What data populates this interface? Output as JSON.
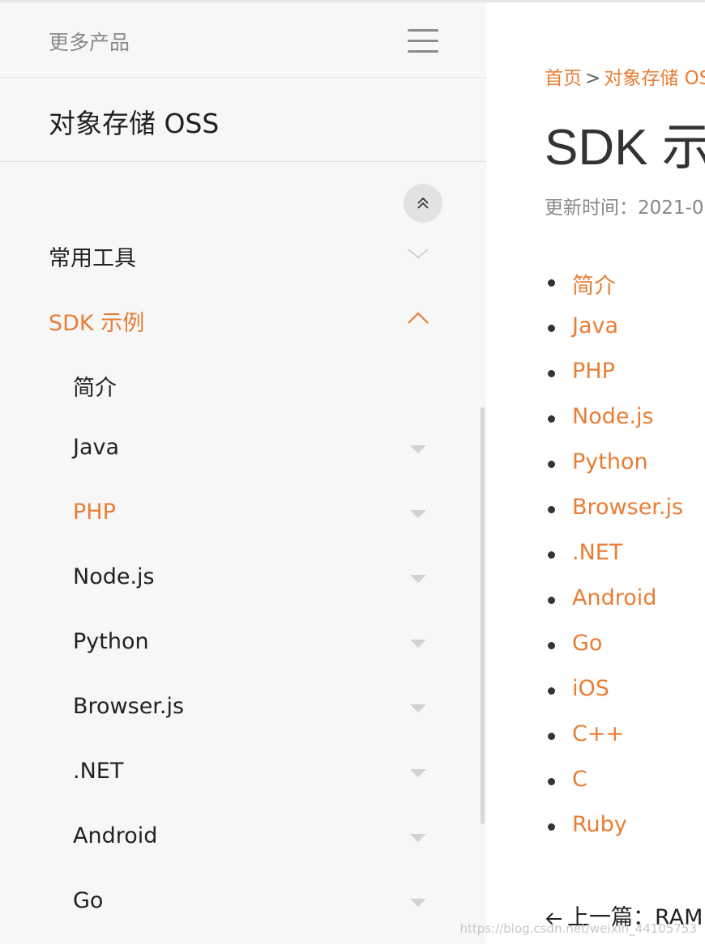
{
  "sidebar": {
    "more_label": "更多产品",
    "product_title": "对象存储 OSS",
    "sections": [
      {
        "label": "常用工具",
        "expanded": false
      },
      {
        "label": "SDK 示例",
        "expanded": true,
        "active": true
      }
    ],
    "sdk_items": [
      {
        "label": "简介"
      },
      {
        "label": "Java"
      },
      {
        "label": "PHP",
        "active": true
      },
      {
        "label": "Node.js"
      },
      {
        "label": "Python"
      },
      {
        "label": "Browser.js"
      },
      {
        "label": ".NET"
      },
      {
        "label": "Android"
      },
      {
        "label": "Go"
      }
    ]
  },
  "main": {
    "breadcrumb": {
      "home": "首页",
      "sep": ">",
      "current": "对象存储 OSS"
    },
    "title": "SDK 示例",
    "updated": "更新时间：2021-0",
    "toc": [
      "简介",
      "Java",
      "PHP",
      "Node.js",
      "Python",
      "Browser.js",
      ".NET",
      "Android",
      "Go",
      "iOS",
      "C++",
      "C",
      "Ruby"
    ],
    "prev": "上一篇：RAM"
  },
  "watermark": "https://blog.csdn.net/weixin_44105753",
  "colors": {
    "accent": "#e97d35",
    "sidebar_bg": "#f7f7f7",
    "text": "#222222"
  }
}
